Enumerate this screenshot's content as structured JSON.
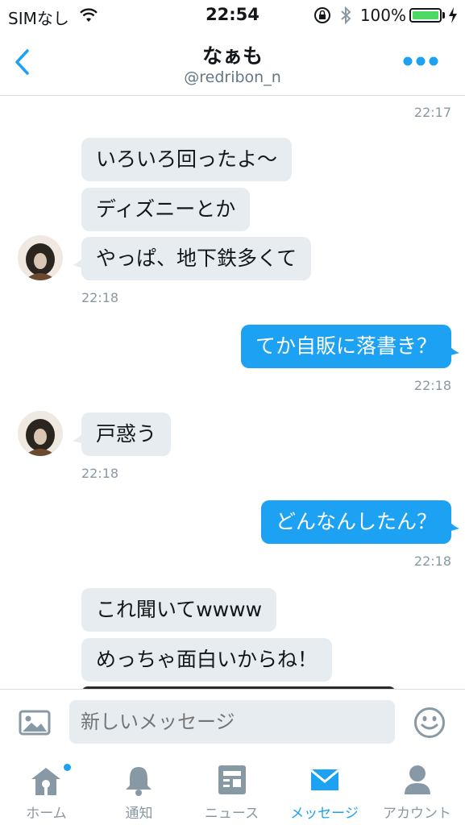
{
  "status_bar": {
    "carrier": "SIMなし",
    "time": "22:54",
    "battery": "100%"
  },
  "nav": {
    "title": "なぁも",
    "handle": "@redribon_n"
  },
  "messages": [
    {
      "id": "ts1",
      "text": "22:17"
    },
    {
      "id": "m1",
      "text": "いろいろ回ったよ〜"
    },
    {
      "id": "m2",
      "text": "ディズニーとか"
    },
    {
      "id": "m3",
      "text": "やっぱ、地下鉄多くて"
    },
    {
      "id": "ts2",
      "text": "22:18"
    },
    {
      "id": "m4",
      "text": "てか自販に落書き？"
    },
    {
      "id": "ts3",
      "text": "22:18"
    },
    {
      "id": "m5",
      "text": "戸惑う"
    },
    {
      "id": "ts4",
      "text": "22:18"
    },
    {
      "id": "m6",
      "text": "どんなんしたん？"
    },
    {
      "id": "ts5",
      "text": "22:18"
    },
    {
      "id": "m7",
      "text": "これ聞いてwwww"
    },
    {
      "id": "m8",
      "text": "めっちゃ面白いからね！"
    }
  ],
  "composer": {
    "placeholder": "新しいメッセージ"
  },
  "tabs": [
    {
      "label": "ホーム",
      "icon": "home-icon"
    },
    {
      "label": "通知",
      "icon": "bell-icon"
    },
    {
      "label": "ニュース",
      "icon": "news-icon"
    },
    {
      "label": "メッセージ",
      "icon": "envelope-icon",
      "active": true
    },
    {
      "label": "アカウント",
      "icon": "person-icon"
    }
  ],
  "colors": {
    "accent": "#1da1f2",
    "received_bubble": "#e6ecf0",
    "muted": "#8899a6",
    "battery": "#4cd964"
  }
}
